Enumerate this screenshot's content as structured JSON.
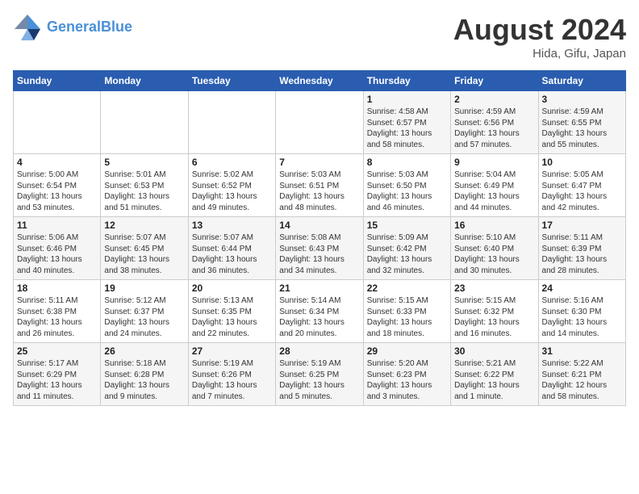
{
  "header": {
    "logo_line1": "General",
    "logo_line2": "Blue",
    "title": "August 2024",
    "subtitle": "Hida, Gifu, Japan"
  },
  "days_of_week": [
    "Sunday",
    "Monday",
    "Tuesday",
    "Wednesday",
    "Thursday",
    "Friday",
    "Saturday"
  ],
  "weeks": [
    [
      {
        "day": "",
        "info": ""
      },
      {
        "day": "",
        "info": ""
      },
      {
        "day": "",
        "info": ""
      },
      {
        "day": "",
        "info": ""
      },
      {
        "day": "1",
        "info": "Sunrise: 4:58 AM\nSunset: 6:57 PM\nDaylight: 13 hours\nand 58 minutes."
      },
      {
        "day": "2",
        "info": "Sunrise: 4:59 AM\nSunset: 6:56 PM\nDaylight: 13 hours\nand 57 minutes."
      },
      {
        "day": "3",
        "info": "Sunrise: 4:59 AM\nSunset: 6:55 PM\nDaylight: 13 hours\nand 55 minutes."
      }
    ],
    [
      {
        "day": "4",
        "info": "Sunrise: 5:00 AM\nSunset: 6:54 PM\nDaylight: 13 hours\nand 53 minutes."
      },
      {
        "day": "5",
        "info": "Sunrise: 5:01 AM\nSunset: 6:53 PM\nDaylight: 13 hours\nand 51 minutes."
      },
      {
        "day": "6",
        "info": "Sunrise: 5:02 AM\nSunset: 6:52 PM\nDaylight: 13 hours\nand 49 minutes."
      },
      {
        "day": "7",
        "info": "Sunrise: 5:03 AM\nSunset: 6:51 PM\nDaylight: 13 hours\nand 48 minutes."
      },
      {
        "day": "8",
        "info": "Sunrise: 5:03 AM\nSunset: 6:50 PM\nDaylight: 13 hours\nand 46 minutes."
      },
      {
        "day": "9",
        "info": "Sunrise: 5:04 AM\nSunset: 6:49 PM\nDaylight: 13 hours\nand 44 minutes."
      },
      {
        "day": "10",
        "info": "Sunrise: 5:05 AM\nSunset: 6:47 PM\nDaylight: 13 hours\nand 42 minutes."
      }
    ],
    [
      {
        "day": "11",
        "info": "Sunrise: 5:06 AM\nSunset: 6:46 PM\nDaylight: 13 hours\nand 40 minutes."
      },
      {
        "day": "12",
        "info": "Sunrise: 5:07 AM\nSunset: 6:45 PM\nDaylight: 13 hours\nand 38 minutes."
      },
      {
        "day": "13",
        "info": "Sunrise: 5:07 AM\nSunset: 6:44 PM\nDaylight: 13 hours\nand 36 minutes."
      },
      {
        "day": "14",
        "info": "Sunrise: 5:08 AM\nSunset: 6:43 PM\nDaylight: 13 hours\nand 34 minutes."
      },
      {
        "day": "15",
        "info": "Sunrise: 5:09 AM\nSunset: 6:42 PM\nDaylight: 13 hours\nand 32 minutes."
      },
      {
        "day": "16",
        "info": "Sunrise: 5:10 AM\nSunset: 6:40 PM\nDaylight: 13 hours\nand 30 minutes."
      },
      {
        "day": "17",
        "info": "Sunrise: 5:11 AM\nSunset: 6:39 PM\nDaylight: 13 hours\nand 28 minutes."
      }
    ],
    [
      {
        "day": "18",
        "info": "Sunrise: 5:11 AM\nSunset: 6:38 PM\nDaylight: 13 hours\nand 26 minutes."
      },
      {
        "day": "19",
        "info": "Sunrise: 5:12 AM\nSunset: 6:37 PM\nDaylight: 13 hours\nand 24 minutes."
      },
      {
        "day": "20",
        "info": "Sunrise: 5:13 AM\nSunset: 6:35 PM\nDaylight: 13 hours\nand 22 minutes."
      },
      {
        "day": "21",
        "info": "Sunrise: 5:14 AM\nSunset: 6:34 PM\nDaylight: 13 hours\nand 20 minutes."
      },
      {
        "day": "22",
        "info": "Sunrise: 5:15 AM\nSunset: 6:33 PM\nDaylight: 13 hours\nand 18 minutes."
      },
      {
        "day": "23",
        "info": "Sunrise: 5:15 AM\nSunset: 6:32 PM\nDaylight: 13 hours\nand 16 minutes."
      },
      {
        "day": "24",
        "info": "Sunrise: 5:16 AM\nSunset: 6:30 PM\nDaylight: 13 hours\nand 14 minutes."
      }
    ],
    [
      {
        "day": "25",
        "info": "Sunrise: 5:17 AM\nSunset: 6:29 PM\nDaylight: 13 hours\nand 11 minutes."
      },
      {
        "day": "26",
        "info": "Sunrise: 5:18 AM\nSunset: 6:28 PM\nDaylight: 13 hours\nand 9 minutes."
      },
      {
        "day": "27",
        "info": "Sunrise: 5:19 AM\nSunset: 6:26 PM\nDaylight: 13 hours\nand 7 minutes."
      },
      {
        "day": "28",
        "info": "Sunrise: 5:19 AM\nSunset: 6:25 PM\nDaylight: 13 hours\nand 5 minutes."
      },
      {
        "day": "29",
        "info": "Sunrise: 5:20 AM\nSunset: 6:23 PM\nDaylight: 13 hours\nand 3 minutes."
      },
      {
        "day": "30",
        "info": "Sunrise: 5:21 AM\nSunset: 6:22 PM\nDaylight: 13 hours\nand 1 minute."
      },
      {
        "day": "31",
        "info": "Sunrise: 5:22 AM\nSunset: 6:21 PM\nDaylight: 12 hours\nand 58 minutes."
      }
    ]
  ]
}
